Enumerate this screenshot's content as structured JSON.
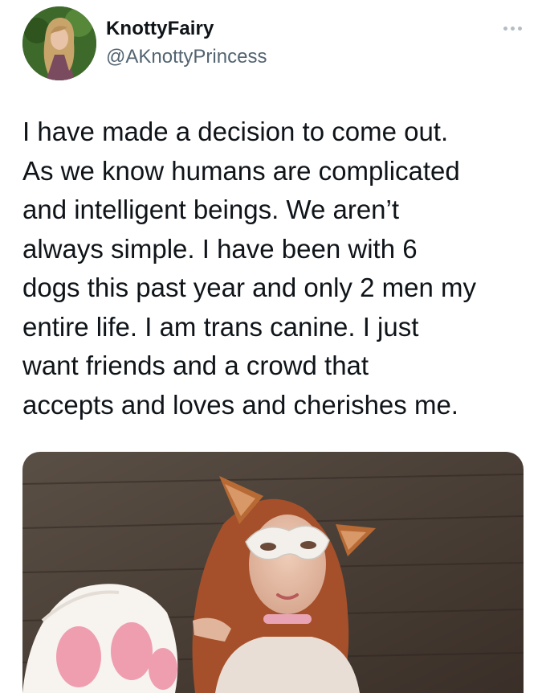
{
  "tweet": {
    "display_name": "KnottyFairy",
    "handle": "@AKnottyPrincess",
    "more_icon": "more-horizontal-icon",
    "text_lines": [
      "I have made a decision to come out.",
      "As we know humans are complicated",
      "and intelligent beings. We aren’t",
      "always simple. I have been with 6",
      "dogs this past year and only 2 men my",
      "entire life. I am trans canine. I just",
      "want friends and a crowd that",
      "accepts and loves and cherishes me."
    ]
  },
  "colors": {
    "text_primary": "#0f1419",
    "text_secondary": "#536471",
    "background": "#ffffff"
  }
}
